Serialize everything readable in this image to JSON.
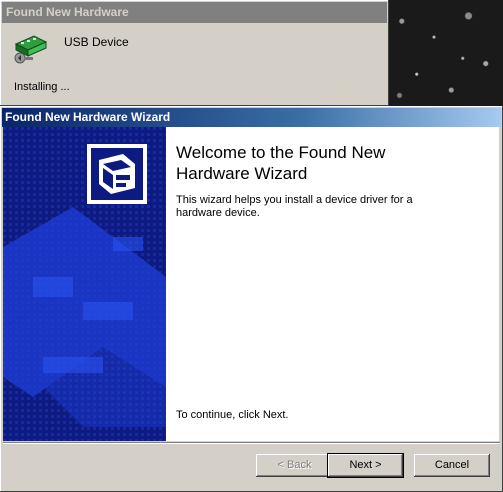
{
  "background_dialog": {
    "title": "Found New Hardware",
    "device_name": "USB Device",
    "status": "Installing ..."
  },
  "wizard": {
    "title": "Found New Hardware Wizard",
    "heading": "Welcome to the Found New Hardware Wizard",
    "description": "This wizard helps you install a device driver for a hardware device.",
    "continue_hint": "To continue, click Next.",
    "buttons": {
      "back": "< Back",
      "next": "Next >",
      "cancel": "Cancel"
    }
  },
  "colors": {
    "titlebar_active_start": "#0a246a",
    "titlebar_active_end": "#a6caf0",
    "titlebar_inactive": "#808080",
    "dialog_face": "#d4d0c8",
    "banner_blue": "#0d1a82"
  },
  "icons": {
    "device": "usb-device-icon",
    "wizard": "hardware-wizard-icon"
  }
}
